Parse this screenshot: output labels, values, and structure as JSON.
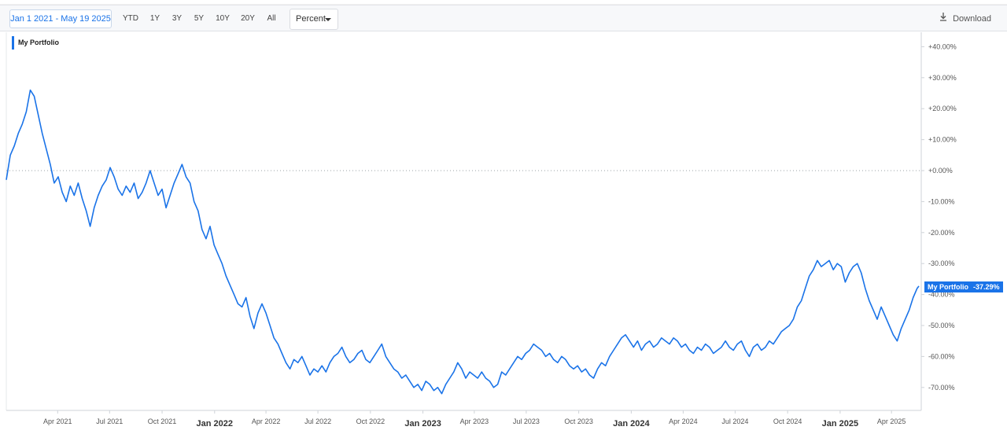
{
  "toolbar": {
    "date_range": "Jan 1 2021 - May 19 2025",
    "periods": [
      "YTD",
      "1Y",
      "3Y",
      "5Y",
      "10Y",
      "20Y",
      "All"
    ],
    "unit_select": "Percent",
    "download_label": "Download",
    "download_icon": "download-icon"
  },
  "colors": {
    "series": "#1a73e8",
    "grid_zero": "#9aa0a6",
    "axis_text": "#555555"
  },
  "end_label": {
    "series": "My Portfolio",
    "value": "-37.29%"
  },
  "chart_data": {
    "type": "line",
    "title": "",
    "xlabel": "",
    "ylabel": "",
    "ylim": [
      -77,
      50
    ],
    "y_ticks": [
      "+40.00%",
      "+30.00%",
      "+20.00%",
      "+10.00%",
      "+0.00%",
      "-10.00%",
      "-20.00%",
      "-30.00%",
      "-40.00%",
      "-50.00%",
      "-60.00%",
      "-70.00%"
    ],
    "y_tick_values": [
      40,
      30,
      20,
      10,
      0,
      -10,
      -20,
      -30,
      -40,
      -50,
      -60,
      -70
    ],
    "x_ticks": [
      {
        "date": "2021-04-01",
        "label": "Apr 2021",
        "major": false
      },
      {
        "date": "2021-07-01",
        "label": "Jul 2021",
        "major": false
      },
      {
        "date": "2021-10-01",
        "label": "Oct 2021",
        "major": false
      },
      {
        "date": "2022-01-01",
        "label": "Jan 2022",
        "major": true
      },
      {
        "date": "2022-04-01",
        "label": "Apr 2022",
        "major": false
      },
      {
        "date": "2022-07-01",
        "label": "Jul 2022",
        "major": false
      },
      {
        "date": "2022-10-01",
        "label": "Oct 2022",
        "major": false
      },
      {
        "date": "2023-01-01",
        "label": "Jan 2023",
        "major": true
      },
      {
        "date": "2023-04-01",
        "label": "Apr 2023",
        "major": false
      },
      {
        "date": "2023-07-01",
        "label": "Jul 2023",
        "major": false
      },
      {
        "date": "2023-10-01",
        "label": "Oct 2023",
        "major": false
      },
      {
        "date": "2024-01-01",
        "label": "Jan 2024",
        "major": true
      },
      {
        "date": "2024-04-01",
        "label": "Apr 2024",
        "major": false
      },
      {
        "date": "2024-07-01",
        "label": "Jul 2024",
        "major": false
      },
      {
        "date": "2024-10-01",
        "label": "Oct 2024",
        "major": false
      },
      {
        "date": "2025-01-01",
        "label": "Jan 2025",
        "major": true
      },
      {
        "date": "2025-04-01",
        "label": "Apr 2025",
        "major": false
      }
    ],
    "zero_line": true,
    "grid": false,
    "legend_position": "top-left",
    "series": [
      {
        "name": "My Portfolio",
        "points": [
          [
            "2021-01-01",
            -3
          ],
          [
            "2021-01-08",
            5
          ],
          [
            "2021-01-15",
            8
          ],
          [
            "2021-01-22",
            12
          ],
          [
            "2021-01-29",
            15
          ],
          [
            "2021-02-05",
            19
          ],
          [
            "2021-02-12",
            26
          ],
          [
            "2021-02-19",
            24
          ],
          [
            "2021-02-26",
            18
          ],
          [
            "2021-03-05",
            12
          ],
          [
            "2021-03-12",
            7
          ],
          [
            "2021-03-19",
            2
          ],
          [
            "2021-03-26",
            -4
          ],
          [
            "2021-04-02",
            -2
          ],
          [
            "2021-04-09",
            -7
          ],
          [
            "2021-04-16",
            -10
          ],
          [
            "2021-04-23",
            -5
          ],
          [
            "2021-04-30",
            -8
          ],
          [
            "2021-05-07",
            -4
          ],
          [
            "2021-05-14",
            -9
          ],
          [
            "2021-05-21",
            -13
          ],
          [
            "2021-05-28",
            -18
          ],
          [
            "2021-06-04",
            -12
          ],
          [
            "2021-06-11",
            -8
          ],
          [
            "2021-06-18",
            -5
          ],
          [
            "2021-06-25",
            -3
          ],
          [
            "2021-07-02",
            1
          ],
          [
            "2021-07-09",
            -2
          ],
          [
            "2021-07-16",
            -6
          ],
          [
            "2021-07-23",
            -8
          ],
          [
            "2021-07-30",
            -5
          ],
          [
            "2021-08-06",
            -7
          ],
          [
            "2021-08-13",
            -4
          ],
          [
            "2021-08-20",
            -9
          ],
          [
            "2021-08-27",
            -7
          ],
          [
            "2021-09-03",
            -4
          ],
          [
            "2021-09-10",
            0
          ],
          [
            "2021-09-17",
            -4
          ],
          [
            "2021-09-24",
            -8
          ],
          [
            "2021-10-01",
            -6
          ],
          [
            "2021-10-08",
            -12
          ],
          [
            "2021-10-15",
            -8
          ],
          [
            "2021-10-22",
            -4
          ],
          [
            "2021-10-29",
            -1
          ],
          [
            "2021-11-05",
            2
          ],
          [
            "2021-11-12",
            -2
          ],
          [
            "2021-11-19",
            -4
          ],
          [
            "2021-11-26",
            -10
          ],
          [
            "2021-12-03",
            -13
          ],
          [
            "2021-12-10",
            -19
          ],
          [
            "2021-12-17",
            -22
          ],
          [
            "2021-12-24",
            -18
          ],
          [
            "2021-12-31",
            -24
          ],
          [
            "2022-01-07",
            -27
          ],
          [
            "2022-01-14",
            -30
          ],
          [
            "2022-01-21",
            -34
          ],
          [
            "2022-01-28",
            -37
          ],
          [
            "2022-02-04",
            -40
          ],
          [
            "2022-02-11",
            -43
          ],
          [
            "2022-02-18",
            -44
          ],
          [
            "2022-02-25",
            -41
          ],
          [
            "2022-03-04",
            -47
          ],
          [
            "2022-03-11",
            -51
          ],
          [
            "2022-03-18",
            -46
          ],
          [
            "2022-03-25",
            -43
          ],
          [
            "2022-04-01",
            -46
          ],
          [
            "2022-04-08",
            -50
          ],
          [
            "2022-04-15",
            -54
          ],
          [
            "2022-04-22",
            -56
          ],
          [
            "2022-04-29",
            -59
          ],
          [
            "2022-05-06",
            -62
          ],
          [
            "2022-05-13",
            -64
          ],
          [
            "2022-05-20",
            -61
          ],
          [
            "2022-05-27",
            -62
          ],
          [
            "2022-06-03",
            -60
          ],
          [
            "2022-06-10",
            -63
          ],
          [
            "2022-06-17",
            -66
          ],
          [
            "2022-06-24",
            -64
          ],
          [
            "2022-07-01",
            -65
          ],
          [
            "2022-07-08",
            -63
          ],
          [
            "2022-07-15",
            -65
          ],
          [
            "2022-07-22",
            -62
          ],
          [
            "2022-07-29",
            -60
          ],
          [
            "2022-08-05",
            -59
          ],
          [
            "2022-08-12",
            -57
          ],
          [
            "2022-08-19",
            -60
          ],
          [
            "2022-08-26",
            -62
          ],
          [
            "2022-09-02",
            -61
          ],
          [
            "2022-09-09",
            -59
          ],
          [
            "2022-09-16",
            -58
          ],
          [
            "2022-09-23",
            -61
          ],
          [
            "2022-09-30",
            -62
          ],
          [
            "2022-10-07",
            -60
          ],
          [
            "2022-10-14",
            -58
          ],
          [
            "2022-10-21",
            -56
          ],
          [
            "2022-10-28",
            -60
          ],
          [
            "2022-11-04",
            -62
          ],
          [
            "2022-11-11",
            -64
          ],
          [
            "2022-11-18",
            -65
          ],
          [
            "2022-11-25",
            -67
          ],
          [
            "2022-12-02",
            -66
          ],
          [
            "2022-12-09",
            -68
          ],
          [
            "2022-12-16",
            -70
          ],
          [
            "2022-12-23",
            -69
          ],
          [
            "2022-12-30",
            -71
          ],
          [
            "2023-01-06",
            -68
          ],
          [
            "2023-01-13",
            -69
          ],
          [
            "2023-01-20",
            -71
          ],
          [
            "2023-01-27",
            -70
          ],
          [
            "2023-02-03",
            -72
          ],
          [
            "2023-02-10",
            -69
          ],
          [
            "2023-02-17",
            -67
          ],
          [
            "2023-02-24",
            -65
          ],
          [
            "2023-03-03",
            -62
          ],
          [
            "2023-03-10",
            -64
          ],
          [
            "2023-03-17",
            -67
          ],
          [
            "2023-03-24",
            -65
          ],
          [
            "2023-03-31",
            -66
          ],
          [
            "2023-04-07",
            -67
          ],
          [
            "2023-04-14",
            -65
          ],
          [
            "2023-04-21",
            -67
          ],
          [
            "2023-04-28",
            -68
          ],
          [
            "2023-05-05",
            -70
          ],
          [
            "2023-05-12",
            -69
          ],
          [
            "2023-05-19",
            -65
          ],
          [
            "2023-05-26",
            -66
          ],
          [
            "2023-06-02",
            -64
          ],
          [
            "2023-06-09",
            -62
          ],
          [
            "2023-06-16",
            -60
          ],
          [
            "2023-06-23",
            -61
          ],
          [
            "2023-06-30",
            -59
          ],
          [
            "2023-07-07",
            -58
          ],
          [
            "2023-07-14",
            -56
          ],
          [
            "2023-07-21",
            -57
          ],
          [
            "2023-07-28",
            -58
          ],
          [
            "2023-08-04",
            -60
          ],
          [
            "2023-08-11",
            -59
          ],
          [
            "2023-08-18",
            -61
          ],
          [
            "2023-08-25",
            -62
          ],
          [
            "2023-09-01",
            -60
          ],
          [
            "2023-09-08",
            -61
          ],
          [
            "2023-09-15",
            -63
          ],
          [
            "2023-09-22",
            -64
          ],
          [
            "2023-09-29",
            -63
          ],
          [
            "2023-10-06",
            -65
          ],
          [
            "2023-10-13",
            -64
          ],
          [
            "2023-10-20",
            -66
          ],
          [
            "2023-10-27",
            -67
          ],
          [
            "2023-11-03",
            -64
          ],
          [
            "2023-11-10",
            -62
          ],
          [
            "2023-11-17",
            -63
          ],
          [
            "2023-11-24",
            -60
          ],
          [
            "2023-12-01",
            -58
          ],
          [
            "2023-12-08",
            -56
          ],
          [
            "2023-12-15",
            -54
          ],
          [
            "2023-12-22",
            -53
          ],
          [
            "2023-12-29",
            -55
          ],
          [
            "2024-01-05",
            -57
          ],
          [
            "2024-01-12",
            -55
          ],
          [
            "2024-01-19",
            -58
          ],
          [
            "2024-01-26",
            -56
          ],
          [
            "2024-02-02",
            -55
          ],
          [
            "2024-02-09",
            -57
          ],
          [
            "2024-02-16",
            -56
          ],
          [
            "2024-02-23",
            -54
          ],
          [
            "2024-03-01",
            -55
          ],
          [
            "2024-03-08",
            -56
          ],
          [
            "2024-03-15",
            -54
          ],
          [
            "2024-03-22",
            -55
          ],
          [
            "2024-03-29",
            -57
          ],
          [
            "2024-04-05",
            -56
          ],
          [
            "2024-04-12",
            -58
          ],
          [
            "2024-04-19",
            -59
          ],
          [
            "2024-04-26",
            -57
          ],
          [
            "2024-05-03",
            -58
          ],
          [
            "2024-05-10",
            -56
          ],
          [
            "2024-05-17",
            -57
          ],
          [
            "2024-05-24",
            -59
          ],
          [
            "2024-05-31",
            -58
          ],
          [
            "2024-06-07",
            -57
          ],
          [
            "2024-06-14",
            -55
          ],
          [
            "2024-06-21",
            -57
          ],
          [
            "2024-06-28",
            -58
          ],
          [
            "2024-07-05",
            -56
          ],
          [
            "2024-07-12",
            -55
          ],
          [
            "2024-07-19",
            -58
          ],
          [
            "2024-07-26",
            -60
          ],
          [
            "2024-08-02",
            -57
          ],
          [
            "2024-08-09",
            -56
          ],
          [
            "2024-08-16",
            -58
          ],
          [
            "2024-08-23",
            -57
          ],
          [
            "2024-08-30",
            -55
          ],
          [
            "2024-09-06",
            -56
          ],
          [
            "2024-09-13",
            -54
          ],
          [
            "2024-09-20",
            -52
          ],
          [
            "2024-09-27",
            -51
          ],
          [
            "2024-10-04",
            -50
          ],
          [
            "2024-10-11",
            -48
          ],
          [
            "2024-10-18",
            -44
          ],
          [
            "2024-10-25",
            -42
          ],
          [
            "2024-11-01",
            -38
          ],
          [
            "2024-11-08",
            -34
          ],
          [
            "2024-11-15",
            -32
          ],
          [
            "2024-11-22",
            -29
          ],
          [
            "2024-11-29",
            -31
          ],
          [
            "2024-12-06",
            -30
          ],
          [
            "2024-12-13",
            -29
          ],
          [
            "2024-12-20",
            -32
          ],
          [
            "2024-12-27",
            -30
          ],
          [
            "2025-01-03",
            -31
          ],
          [
            "2025-01-10",
            -36
          ],
          [
            "2025-01-17",
            -33
          ],
          [
            "2025-01-24",
            -31
          ],
          [
            "2025-01-31",
            -30
          ],
          [
            "2025-02-07",
            -33
          ],
          [
            "2025-02-14",
            -38
          ],
          [
            "2025-02-21",
            -42
          ],
          [
            "2025-02-28",
            -45
          ],
          [
            "2025-03-07",
            -48
          ],
          [
            "2025-03-14",
            -44
          ],
          [
            "2025-03-21",
            -47
          ],
          [
            "2025-03-28",
            -50
          ],
          [
            "2025-04-04",
            -53
          ],
          [
            "2025-04-11",
            -55
          ],
          [
            "2025-04-18",
            -51
          ],
          [
            "2025-04-25",
            -48
          ],
          [
            "2025-05-02",
            -45
          ],
          [
            "2025-05-09",
            -41
          ],
          [
            "2025-05-16",
            -38
          ],
          [
            "2025-05-19",
            -37.29
          ]
        ]
      }
    ]
  }
}
